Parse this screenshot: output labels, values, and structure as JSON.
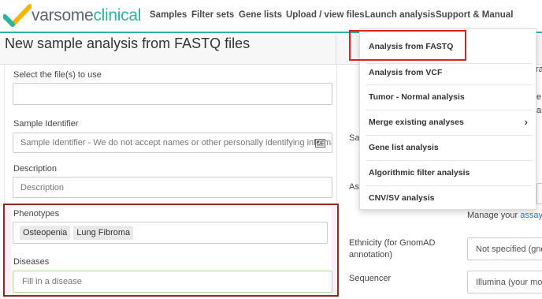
{
  "brand": {
    "part1": "varsome",
    "part2": "clinical",
    "check_color": "#f4b400",
    "accent": "#2bb5a0"
  },
  "nav": {
    "samples": "Samples",
    "filter_sets": "Filter sets",
    "gene_lists": "Gene lists",
    "upload": "Upload / view files",
    "launch": "Launch analysis",
    "support": "Support & Manual"
  },
  "page": {
    "title": "New sample analysis from FASTQ files"
  },
  "form": {
    "files_label": "Select the file(s) to use",
    "files_value": "",
    "sample_id_label": "Sample Identifier",
    "sample_id_placeholder": "Sample Identifier - We do not accept names or other personally identifying information",
    "description_label": "Description",
    "description_placeholder": "Description",
    "phenotypes_label": "Phenotypes",
    "phenotypes": [
      "Osteopenia",
      "Lung Fibroma"
    ],
    "diseases_label": "Diseases",
    "diseases_placeholder": "Fill in a disease"
  },
  "right": {
    "partial_sa": "Sa",
    "partial_as": "As",
    "partial_ra": "ra",
    "partial_e": "e",
    "partial_am": "am",
    "manage_text": "Manage your",
    "manage_link": "assay p",
    "ethnicity_label_1": "Ethnicity (for GnomAD",
    "ethnicity_label_2": "annotation)",
    "ethnicity_value": "Not specified (gnom",
    "sequencer_label": "Sequencer",
    "sequencer_value": "Illumina (your mode"
  },
  "dropdown": {
    "items": [
      "Analysis from FASTQ",
      "Analysis from VCF",
      "Tumor - Normal analysis",
      "Merge existing analyses",
      "Gene list analysis",
      "Algorithmic filter analysis",
      "CNV/SV analysis"
    ],
    "submenu_icon": "chevron-right-icon"
  }
}
